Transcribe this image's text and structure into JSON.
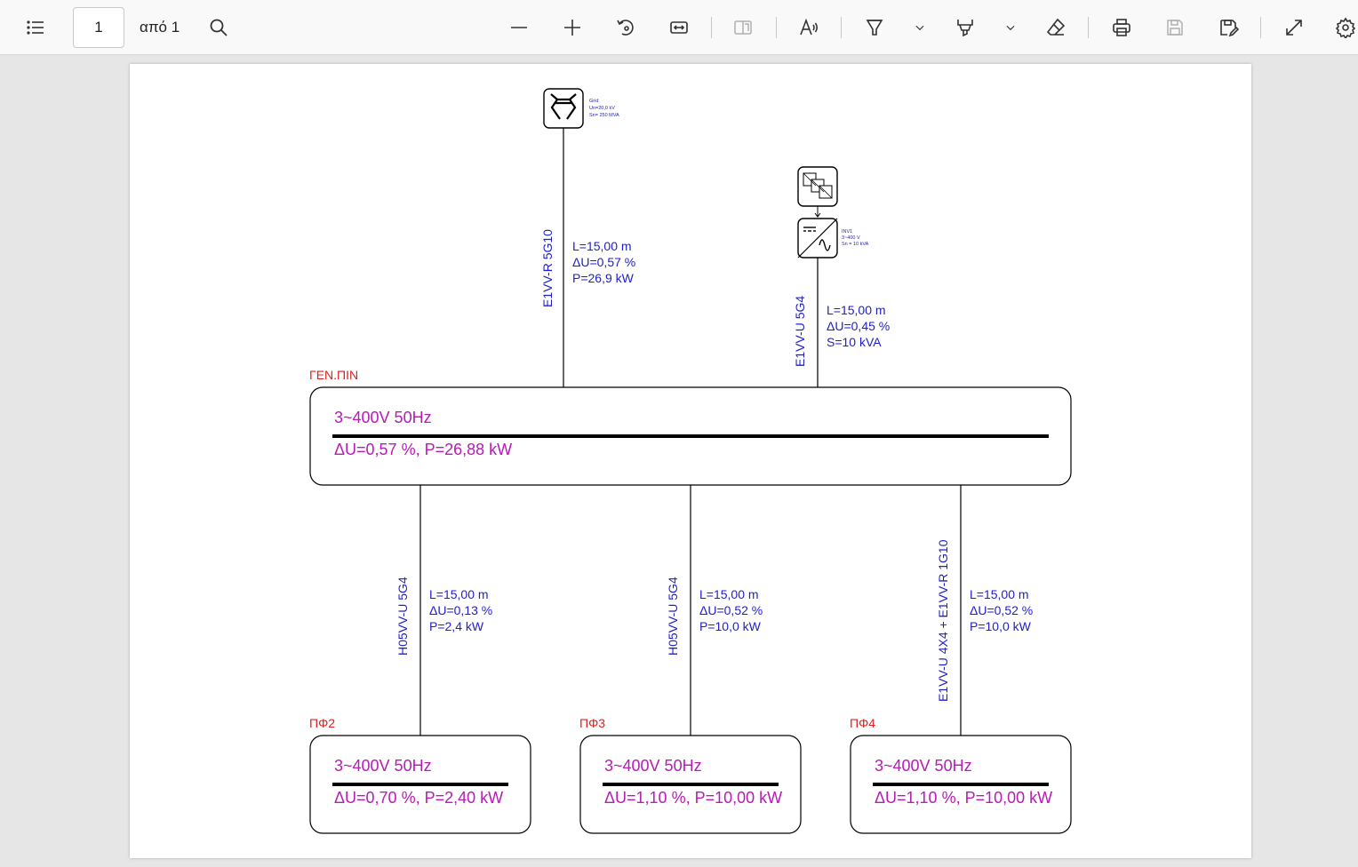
{
  "toolbar": {
    "current_page": "1",
    "page_of": "από 1",
    "icons": [
      "toc-icon",
      "search-icon",
      "zoom-out-icon",
      "zoom-in-icon",
      "rotate-icon",
      "fit-width-icon",
      "page-view-icon",
      "read-aloud-icon",
      "draw-icon",
      "chevron-down-icon",
      "highlight-icon",
      "chevron-down-icon",
      "eraser-icon",
      "print-icon",
      "save-icon",
      "save-as-icon",
      "fullscreen-icon",
      "settings-icon"
    ]
  },
  "diagram": {
    "grid": {
      "label1": "Grid",
      "label2": "Un=20,0 kV",
      "label3": "Sn= 250 MVA",
      "cable": "E1VV-R 5G10",
      "length": "L=15,00 m",
      "drop": "ΔU=0,57 %",
      "power": "P=26,9 kW"
    },
    "inverter": {
      "label1": "INV1",
      "label2": "3~400 V",
      "label3": "Sn = 10 kVA",
      "cable": "E1VV-U 5G4",
      "length": "L=15,00 m",
      "drop": "ΔU=0,45 %",
      "power": "S=10 kVA"
    },
    "main_panel": {
      "name": "ΓΕΝ.ΠΙΝ",
      "voltage": "3~400V 50Hz",
      "summary": "ΔU=0,57 %, P=26,88 kW"
    },
    "feeders": [
      {
        "cable": "H05VV-U 5G4",
        "length": "L=15,00 m",
        "drop": "ΔU=0,13 %",
        "power": "P=2,4 kW"
      },
      {
        "cable": "H05VV-U 5G4",
        "length": "L=15,00 m",
        "drop": "ΔU=0,52 %",
        "power": "P=10,0 kW"
      },
      {
        "cable": "E1VV-U 4X4 + E1VV-R 1G10",
        "length": "L=15,00 m",
        "drop": "ΔU=0,52 %",
        "power": "P=10,0 kW"
      }
    ],
    "sub_panels": [
      {
        "name": "ΠΦ2",
        "voltage": "3~400V 50Hz",
        "summary": "ΔU=0,70 %, P=2,40 kW"
      },
      {
        "name": "ΠΦ3",
        "voltage": "3~400V 50Hz",
        "summary": "ΔU=1,10 %, P=10,00 kW"
      },
      {
        "name": "ΠΦ4",
        "voltage": "3~400V 50Hz",
        "summary": "ΔU=1,10 %, P=10,00 kW"
      }
    ],
    "colors": {
      "cable_text": "#1e1ecc",
      "panel_name": "#e02020",
      "panel_text": "#b81bb8",
      "line": "#000000"
    }
  }
}
